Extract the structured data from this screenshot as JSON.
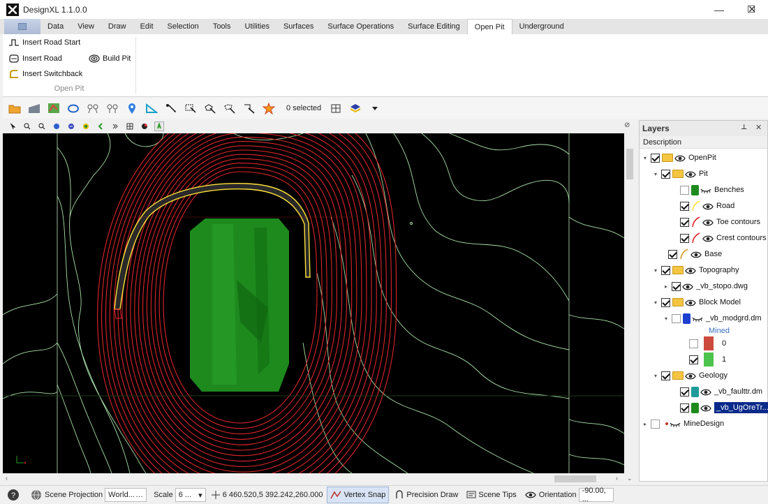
{
  "window": {
    "title": "DesignXL 1.1.0.0",
    "min": "—",
    "max": "☐",
    "close": "✕"
  },
  "menu": {
    "tabs": [
      "Data",
      "View",
      "Draw",
      "Edit",
      "Selection",
      "Tools",
      "Utilities",
      "Surfaces",
      "Surface Operations",
      "Surface Editing",
      "Open Pit",
      "Underground"
    ],
    "active": "Open Pit"
  },
  "ribbon": {
    "insert_road_start": "Insert Road Start",
    "insert_road": "Insert Road",
    "build_pit": "Build Pit",
    "insert_switchback": "Insert Switchback",
    "group_label": "Open Pit"
  },
  "toolbar": {
    "selected_count": "0 selected"
  },
  "layers": {
    "title": "Layers",
    "column": "Description",
    "rows": [
      {
        "label": "OpenPit"
      },
      {
        "label": "Pit"
      },
      {
        "label": "Benches"
      },
      {
        "label": "Road"
      },
      {
        "label": "Toe contours"
      },
      {
        "label": "Crest contours"
      },
      {
        "label": "Base"
      },
      {
        "label": "Topography"
      },
      {
        "label": "_vb_stopo.dwg"
      },
      {
        "label": "Block Model"
      },
      {
        "label": "_vb_modgrd.dm"
      },
      {
        "label": "Mined"
      },
      {
        "label": "0"
      },
      {
        "label": "1"
      },
      {
        "label": "Geology"
      },
      {
        "label": "_vb_faulttr.dm"
      },
      {
        "label": "_vb_UgOreTr...."
      },
      {
        "label": "MineDesign"
      }
    ]
  },
  "status": {
    "help": "?",
    "scene_projection_label": "Scene Projection",
    "scene_projection_value": "World...",
    "scale_label": "Scale",
    "scale_value": "6 ...",
    "coordinates": "6 460.520,5 392.242,260.000",
    "vertex_snap": "Vertex Snap",
    "precision_draw": "Precision Draw",
    "scene_tips": "Scene Tips",
    "orientation_label": "Orientation",
    "orientation_value": "-90.00, ..."
  },
  "colors": {
    "pit_contour": "#e0242c",
    "road": "#ffe23a",
    "ore_body": "#1e8a1e",
    "topo": "#9ad89a",
    "selection": "#0a2a8a"
  }
}
